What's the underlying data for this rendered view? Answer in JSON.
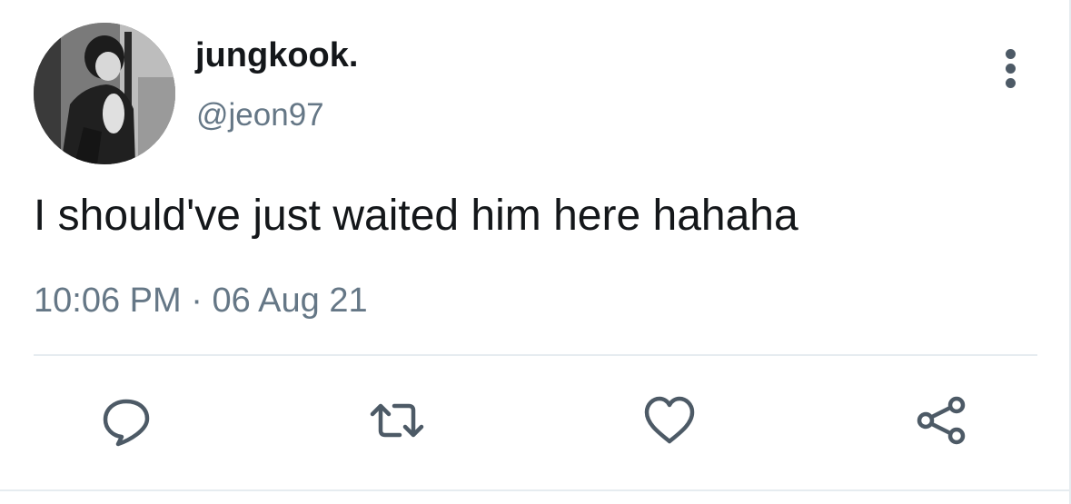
{
  "tweet": {
    "display_name": "jungkook.",
    "handle": "@jeon97",
    "text": "I should've just waited him here hahaha",
    "time": "10:06 PM",
    "separator": "·",
    "date": "06 Aug 21"
  },
  "icons": {
    "more": "more-vertical-icon",
    "reply": "reply-icon",
    "retweet": "retweet-icon",
    "like": "heart-icon",
    "share": "share-icon"
  },
  "colors": {
    "text_primary": "#14171a",
    "text_secondary": "#657786",
    "icon": "#4d5a66",
    "divider": "#e6ecf0"
  }
}
